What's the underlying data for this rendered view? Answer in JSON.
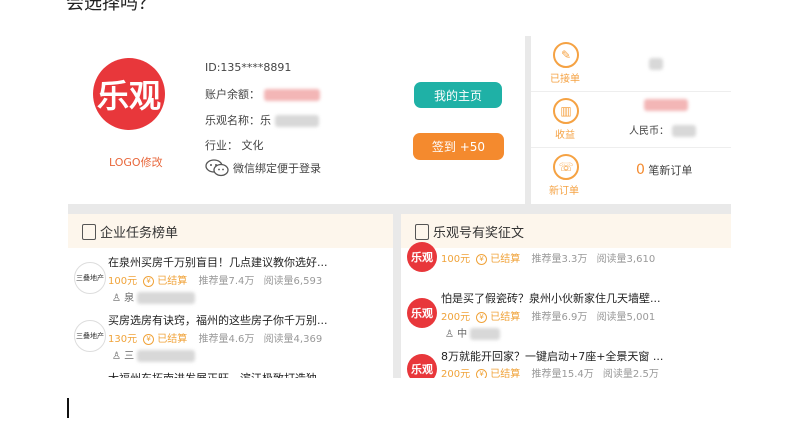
{
  "top_text": "会选择吗？",
  "profile": {
    "avatar_text": "乐观",
    "logo_edit": "LOGO修改",
    "id_line": "ID:135****8891",
    "balance_label": "账户余额：",
    "name_label": "乐观名称：",
    "name_visible": "乐",
    "industry_label": "行业：",
    "industry_value": "文化",
    "wechat_text": "微信绑定便于登录"
  },
  "buttons": {
    "home": "我的主页",
    "sign": "签到 +50"
  },
  "stats": {
    "accepted_label": "已接单",
    "income_label": "收益",
    "income_rmb_label": "人民币：",
    "new_order_label": "新订单",
    "new_order_count": "0",
    "new_order_text": "笔新订单"
  },
  "left_panel": {
    "title": "企业任务榜单",
    "items": [
      {
        "thumb": "三叠地产",
        "title": "在泉州买房千万别盲目！几点建议教你选好...",
        "amount": "100元",
        "status": "已结算",
        "recommend": "推荐量7.4万",
        "reads": "阅读量6,593",
        "sub": "泉"
      },
      {
        "thumb": "三叠地产",
        "title": "买房选房有诀窍，福州的这些房子你千万别...",
        "amount": "130元",
        "status": "已结算",
        "recommend": "推荐量4.6万",
        "reads": "阅读量4,369",
        "sub": "三"
      },
      {
        "thumb": "",
        "title": "大福州东拓南进发展正旺，滨江极致打造独...",
        "amount": "",
        "status": "",
        "recommend": "",
        "reads": "",
        "sub": ""
      }
    ]
  },
  "right_panel": {
    "title": "乐观号有奖征文",
    "items": [
      {
        "thumb": "乐观",
        "title": "",
        "amount": "100元",
        "status": "已结算",
        "recommend": "推荐量3.3万",
        "reads": "阅读量3,610",
        "sub": ""
      },
      {
        "thumb": "乐观",
        "title": "怕是买了假瓷砖？泉州小伙新家住几天墙壁...",
        "amount": "200元",
        "status": "已结算",
        "recommend": "推荐量6.9万",
        "reads": "阅读量5,001",
        "sub": "中"
      },
      {
        "thumb": "乐观",
        "title": "8万就能开回家？一键启动+7座+全景天窗 ...",
        "amount": "200元",
        "status": "已结算",
        "recommend": "推荐量15.4万",
        "reads": "阅读量2.5万",
        "sub": ""
      }
    ]
  }
}
